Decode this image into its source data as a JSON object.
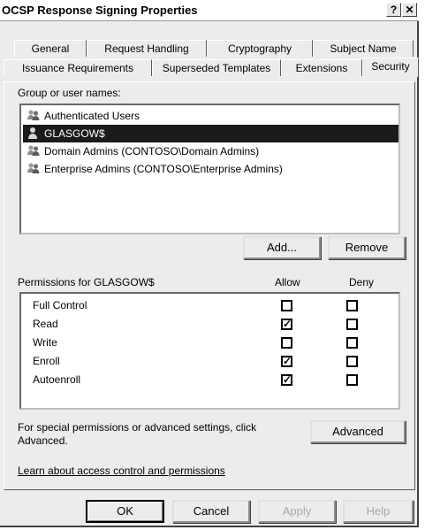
{
  "window": {
    "title": "OCSP Response Signing Properties",
    "help_glyph": "?",
    "close_glyph": "✕"
  },
  "tabs": {
    "row1": [
      "General",
      "Request Handling",
      "Cryptography",
      "Subject Name"
    ],
    "row2": [
      "Issuance Requirements",
      "Superseded Templates",
      "Extensions",
      "Security"
    ],
    "active": "Security"
  },
  "security": {
    "group_label": "Group or user names:",
    "users": [
      {
        "name": "Authenticated Users",
        "icon": "user-group-icon",
        "selected": false
      },
      {
        "name": "GLASGOW$",
        "icon": "user-icon",
        "selected": true
      },
      {
        "name": "Domain Admins (CONTOSO\\Domain Admins)",
        "icon": "user-group-icon",
        "selected": false
      },
      {
        "name": "Enterprise Admins (CONTOSO\\Enterprise Admins)",
        "icon": "user-group-icon",
        "selected": false
      }
    ],
    "add_label": "Add...",
    "remove_label": "Remove",
    "permissions_label": "Permissions for GLASGOW$",
    "allow_label": "Allow",
    "deny_label": "Deny",
    "permissions": [
      {
        "name": "Full Control",
        "allow": false,
        "deny": false
      },
      {
        "name": "Read",
        "allow": true,
        "deny": false
      },
      {
        "name": "Write",
        "allow": false,
        "deny": false
      },
      {
        "name": "Enroll",
        "allow": true,
        "deny": false
      },
      {
        "name": "Autoenroll",
        "allow": true,
        "deny": false
      }
    ],
    "special_text_1": "For special permissions or advanced settings, click",
    "special_text_2": "Advanced.",
    "advanced_label": "Advanced",
    "learn_link": "Learn about access control and permissions"
  },
  "footer": {
    "ok": "OK",
    "cancel": "Cancel",
    "apply": "Apply",
    "help": "Help"
  },
  "colors": {
    "selection": "#1b1b1b",
    "dialog_bg": "#ececec",
    "disabled_text": "#a8a8a8"
  }
}
